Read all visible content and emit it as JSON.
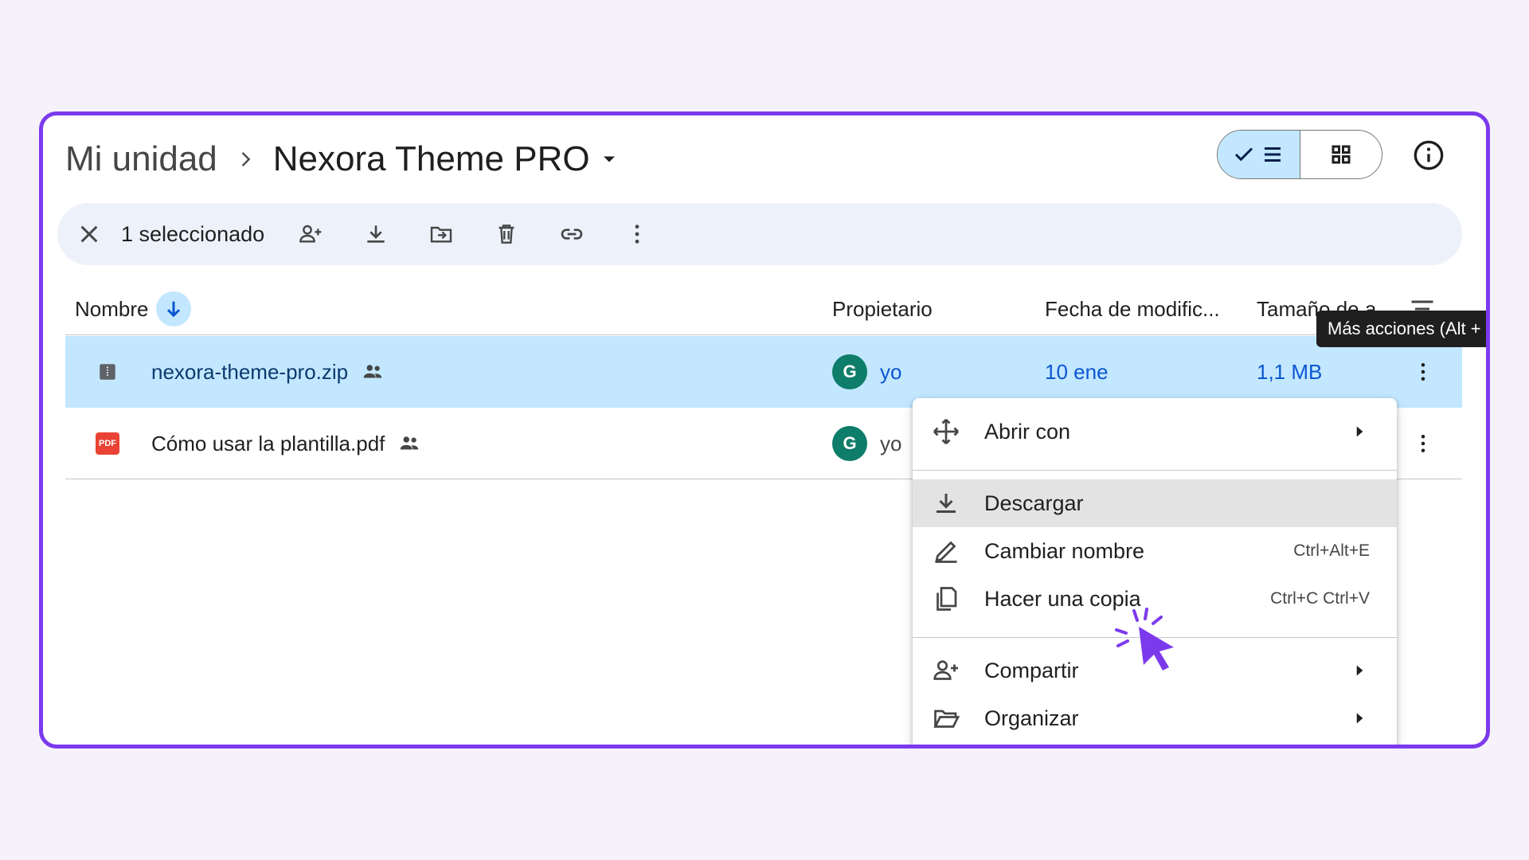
{
  "breadcrumb": {
    "root": "Mi unidad",
    "current": "Nexora Theme PRO"
  },
  "view_toggle": {
    "list_icon": "check-list-icon",
    "grid_icon": "grid-icon"
  },
  "info_icon": "info-icon",
  "action_bar": {
    "selected_count": "1 seleccionado",
    "icons": [
      "close-icon",
      "add-person-icon",
      "download-icon",
      "move-to-folder-icon",
      "trash-icon",
      "link-icon",
      "more-vert-icon"
    ]
  },
  "columns": {
    "name": "Nombre",
    "owner": "Propietario",
    "modified": "Fecha de modific...",
    "size": "Tamaño de a"
  },
  "files": [
    {
      "name": "nexora-theme-pro.zip",
      "type": "zip",
      "shared": true,
      "owner_initial": "G",
      "owner": "yo",
      "modified": "10 ene",
      "size": "1,1 MB",
      "selected": true
    },
    {
      "name": "Cómo usar la plantilla.pdf",
      "type": "pdf",
      "shared": true,
      "owner_initial": "G",
      "owner": "yo",
      "modified": "",
      "size": "",
      "selected": false
    }
  ],
  "pdf_badge": "PDF",
  "tooltip": "Más acciones (Alt +",
  "context_menu": {
    "open_with": "Abrir con",
    "download": "Descargar",
    "rename": "Cambiar nombre",
    "rename_shortcut": "Ctrl+Alt+E",
    "copy": "Hacer una copia",
    "copy_shortcut": "Ctrl+C Ctrl+V",
    "share": "Compartir",
    "organize": "Organizar"
  },
  "colors": {
    "accent": "#7c3aed",
    "selection": "#c2e7ff",
    "avatar": "#0e7d6a",
    "pdf_red": "#ea4335"
  }
}
